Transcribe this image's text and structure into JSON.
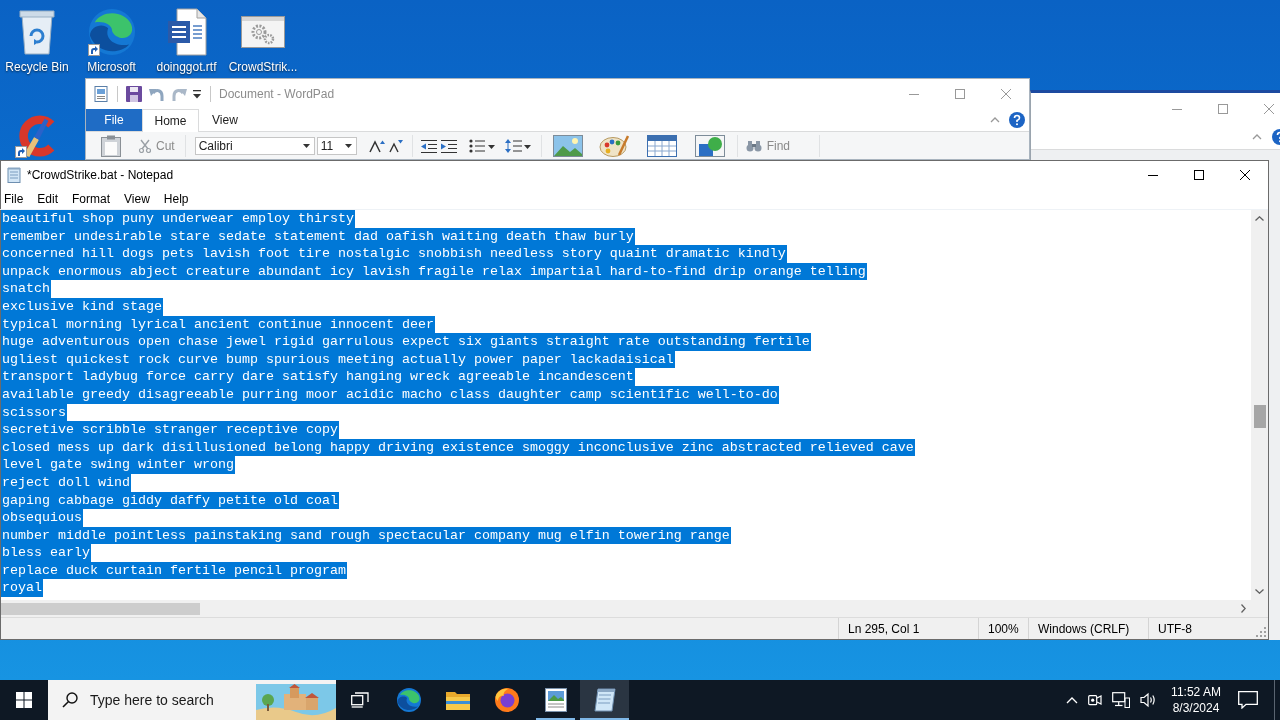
{
  "desktop_icons": [
    {
      "kind": "recycle_bin",
      "label": "Recycle Bin",
      "shortcut": false
    },
    {
      "kind": "browser",
      "label": "Microsoft",
      "shortcut": true
    },
    {
      "kind": "document",
      "label": "doinggot.rtf",
      "shortcut": false
    },
    {
      "kind": "batch_file",
      "label": "CrowdStrik...",
      "shortcut": false
    },
    {
      "kind": "cleaner",
      "shortcut": true
    }
  ],
  "wordpad": {
    "title": "Document - WordPad",
    "tabs": [
      {
        "label": "File",
        "kind": "file",
        "selected": false
      },
      {
        "label": "Home",
        "kind": "tab",
        "selected": true
      },
      {
        "label": "View",
        "kind": "tab",
        "selected": false
      }
    ],
    "ribbon": {
      "cut": "Cut",
      "font_family": "Calibri",
      "font_size": "11",
      "find": "Find"
    }
  },
  "notepad": {
    "title": "*CrowdStrike.bat - Notepad",
    "menu": [
      "File",
      "Edit",
      "Format",
      "View",
      "Help"
    ],
    "lines": [
      {
        "text": "beautiful shop puny underwear employ thirsty",
        "selected": true
      },
      {
        "text": "remember undesirable stare sedate statement dad oafish waiting death thaw burly",
        "selected": true
      },
      {
        "text": "concerned hill dogs pets lavish foot tire nostalgic snobbish needless story quaint dramatic kindly",
        "selected": true
      },
      {
        "text": "unpack enormous abject creature abundant icy lavish fragile relax impartial hard-to-find drip orange telling",
        "selected": true
      },
      {
        "text": "snatch",
        "selected": true
      },
      {
        "text": "exclusive kind stage",
        "selected": true
      },
      {
        "text": "typical morning lyrical ancient continue innocent deer",
        "selected": true
      },
      {
        "text": "huge adventurous open chase jewel rigid garrulous expect six giants straight rate outstanding fertile",
        "selected": true
      },
      {
        "text": "ugliest quickest rock curve bump spurious meeting actually power paper lackadaisical",
        "selected": true
      },
      {
        "text": "transport ladybug force carry dare satisfy hanging wreck agreeable incandescent",
        "selected": true
      },
      {
        "text": "available greedy disagreeable purring moor acidic macho class daughter camp scientific well-to-do",
        "selected": true
      },
      {
        "text": "scissors",
        "selected": true
      },
      {
        "text": "secretive scribble stranger receptive copy",
        "selected": true
      },
      {
        "text": "closed mess up dark disillusioned belong happy driving existence smoggy inconclusive zinc abstracted relieved cave",
        "selected": true
      },
      {
        "text": "level gate swing winter wrong",
        "selected": true
      },
      {
        "text": "reject doll wind",
        "selected": true
      },
      {
        "text": "gaping cabbage giddy daffy petite old coal",
        "selected": true
      },
      {
        "text": "obsequious",
        "selected": true
      },
      {
        "text": "number middle pointless painstaking sand rough spectacular company mug elfin towering range",
        "selected": true
      },
      {
        "text": "bless early",
        "selected": true
      },
      {
        "text": "replace duck curtain fertile pencil program",
        "selected": true
      },
      {
        "text": "royal",
        "selected": true
      }
    ],
    "status_bar": {
      "position": "Ln 295, Col 1",
      "zoom": "100%",
      "line_ending": "Windows (CRLF)",
      "encoding": "UTF-8"
    }
  },
  "taskbar": {
    "search_placeholder": "Type here to search",
    "apps": [
      {
        "kind": "task_view",
        "running": false,
        "active": false
      },
      {
        "kind": "browser",
        "running": false,
        "active": false
      },
      {
        "kind": "file_explorer",
        "running": false,
        "active": false
      },
      {
        "kind": "firefox",
        "running": false,
        "active": false
      },
      {
        "kind": "wordpad",
        "running": true,
        "active": false
      },
      {
        "kind": "notepad",
        "running": true,
        "active": true
      }
    ],
    "time": "11:52 AM",
    "date": "8/3/2024"
  }
}
